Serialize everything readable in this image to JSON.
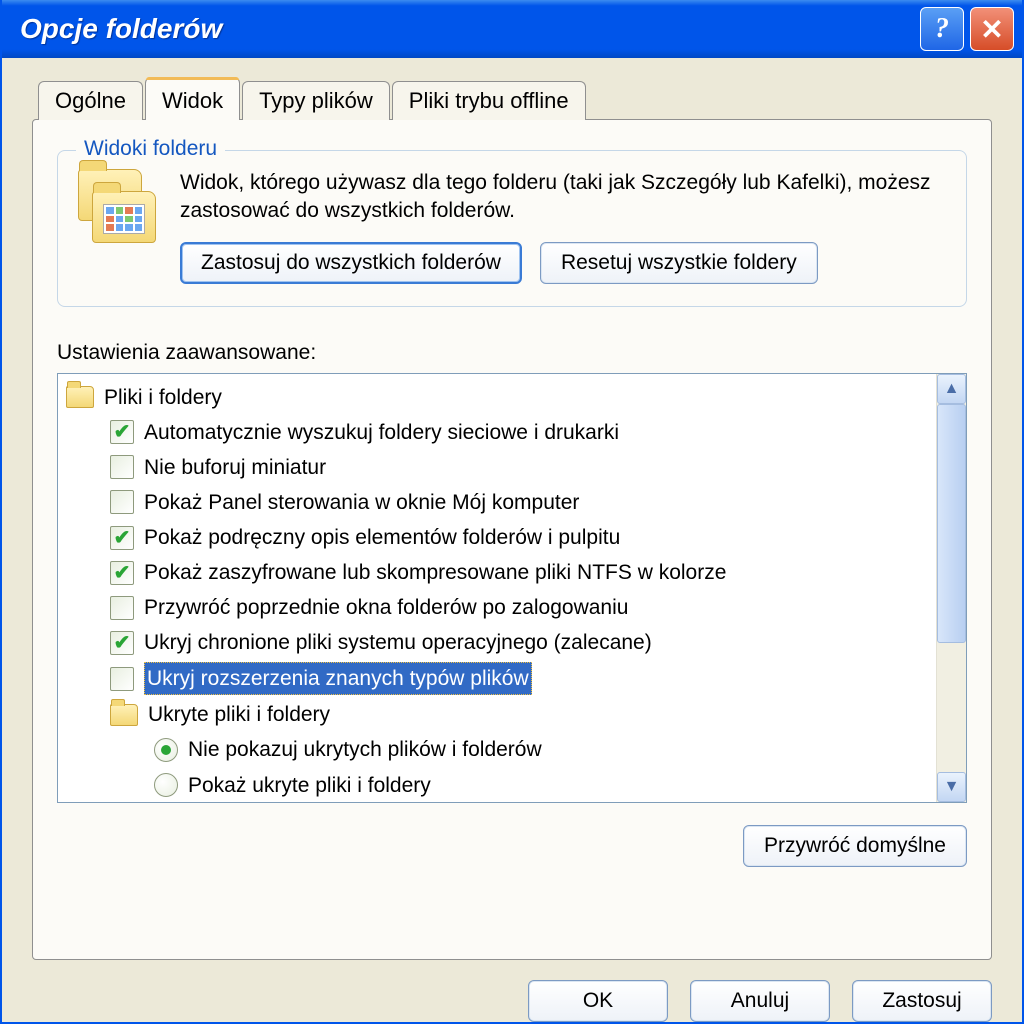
{
  "titlebar": {
    "title": "Opcje folderów"
  },
  "tabs": {
    "general": "Ogólne",
    "view": "Widok",
    "filetypes": "Typy plików",
    "offline": "Pliki trybu offline"
  },
  "groupbox": {
    "title": "Widoki folderu",
    "description": "Widok, którego używasz dla tego folderu (taki jak Szczegóły lub Kafelki), możesz zastosować do wszystkich folderów.",
    "apply_all": "Zastosuj do wszystkich folderów",
    "reset_all": "Resetuj wszystkie foldery"
  },
  "advanced": {
    "label": "Ustawienia zaawansowane:",
    "category_files_folders": "Pliki i foldery",
    "items": [
      {
        "checked": true,
        "label": "Automatycznie wyszukuj foldery sieciowe i drukarki"
      },
      {
        "checked": false,
        "label": "Nie buforuj miniatur"
      },
      {
        "checked": false,
        "label": "Pokaż Panel sterowania w oknie Mój komputer"
      },
      {
        "checked": true,
        "label": "Pokaż podręczny opis elementów folderów i pulpitu"
      },
      {
        "checked": true,
        "label": "Pokaż zaszyfrowane lub skompresowane pliki NTFS w kolorze"
      },
      {
        "checked": false,
        "label": "Przywróć poprzednie okna folderów po zalogowaniu"
      },
      {
        "checked": true,
        "label": "Ukryj chronione pliki systemu operacyjnego (zalecane)"
      },
      {
        "checked": false,
        "label": "Ukryj rozszerzenia znanych typów plików",
        "selected": true
      }
    ],
    "category_hidden": "Ukryte pliki i foldery",
    "radio": [
      {
        "selected": true,
        "label": "Nie pokazuj ukrytych plików i folderów"
      },
      {
        "selected": false,
        "label": "Pokaż ukryte pliki i foldery"
      }
    ]
  },
  "buttons": {
    "restore_defaults": "Przywróć domyślne",
    "ok": "OK",
    "cancel": "Anuluj",
    "apply": "Zastosuj"
  }
}
